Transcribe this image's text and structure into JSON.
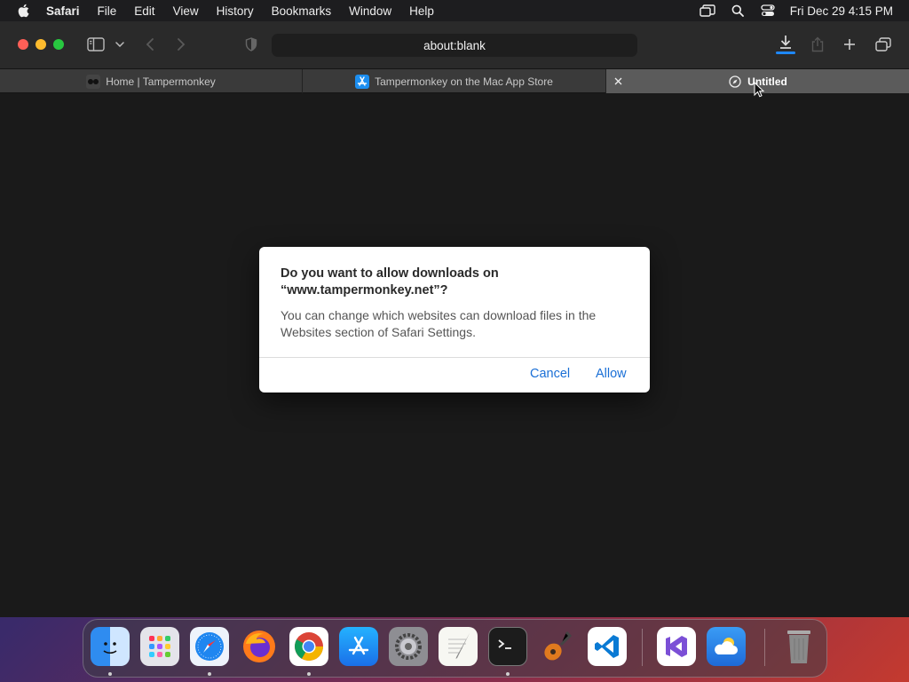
{
  "menubar": {
    "app_name": "Safari",
    "items": [
      "File",
      "Edit",
      "View",
      "History",
      "Bookmarks",
      "Window",
      "Help"
    ],
    "clock": "Fri Dec 29  4:15 PM"
  },
  "toolbar": {
    "address": "about:blank"
  },
  "tabs": [
    {
      "title": "Home | Tampermonkey",
      "icon": "tampermonkey-icon"
    },
    {
      "title": "Tampermonkey on the Mac App Store",
      "icon": "app-store-icon"
    },
    {
      "title": "Untitled",
      "icon": "compass-icon",
      "active": true
    }
  ],
  "dialog": {
    "title": "Do you want to allow downloads on “www.tampermonkey.net”?",
    "message": "You can change which websites can download files in the Websites section of Safari Settings.",
    "cancel_label": "Cancel",
    "allow_label": "Allow"
  },
  "dock": {
    "apps": [
      {
        "name": "finder",
        "icon": "finder-icon",
        "color": "#2f8cf0"
      },
      {
        "name": "launchpad",
        "icon": "launchpad-icon",
        "color": "#d8d8de"
      },
      {
        "name": "safari",
        "icon": "safari-icon",
        "color": "#eef3fb"
      },
      {
        "name": "firefox",
        "icon": "firefox-icon",
        "color": "#6a2fd0"
      },
      {
        "name": "chrome",
        "icon": "chrome-icon",
        "color": "#ffffff"
      },
      {
        "name": "app-store",
        "icon": "app-store-icon",
        "color": "#1c8ef0"
      },
      {
        "name": "system-settings",
        "icon": "gear-icon",
        "color": "#8e8e93"
      },
      {
        "name": "textedit",
        "icon": "textedit-icon",
        "color": "#f4f4f4"
      },
      {
        "name": "terminal",
        "icon": "terminal-icon",
        "color": "#1c1c1c"
      },
      {
        "name": "garageband",
        "icon": "guitar-icon",
        "color": "#3a2a20"
      },
      {
        "name": "vscode",
        "icon": "vscode-icon",
        "color": "#ffffff"
      },
      {
        "name": "visual-studio",
        "icon": "visual-studio-icon",
        "color": "#ffffff"
      },
      {
        "name": "weather",
        "icon": "weather-icon",
        "color": "#2b7fe0"
      },
      {
        "name": "trash",
        "icon": "trash-icon",
        "color": "#8a8a8a"
      }
    ]
  },
  "colors": {
    "accent": "#1a6fd6",
    "close": "#fe5f57",
    "minimize": "#febc2e",
    "maximize": "#28c840",
    "download_indicator": "#1e88ff"
  }
}
